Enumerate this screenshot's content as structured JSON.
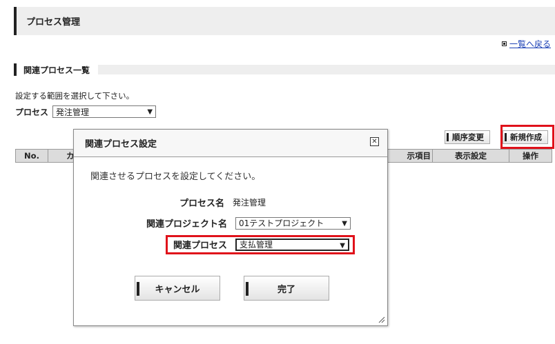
{
  "page": {
    "title": "プロセス管理",
    "back_link": "一覧へ戻る",
    "section_title": "関連プロセス一覧",
    "instruction": "設定する範囲を選択して下さい。",
    "process_label": "プロセス",
    "process_select": "発注管理"
  },
  "toolbar": {
    "reorder_label": "順序変更",
    "new_label": "新規作成"
  },
  "table": {
    "headers": [
      "No.",
      "カ",
      "示項目",
      "表示設定",
      "操作"
    ]
  },
  "modal": {
    "title": "関連プロセス設定",
    "message": "関連させるプロセスを設定してください。",
    "process_name_label": "プロセス名",
    "process_name_value": "発注管理",
    "related_project_label": "関連プロジェクト名",
    "related_project_value": "01テストプロジェクト",
    "related_process_label": "関連プロセス",
    "related_process_value": "支払管理",
    "cancel_label": "キャンセル",
    "done_label": "完了"
  },
  "colors": {
    "highlight": "#e0111a",
    "header_bg": "#eeeeee",
    "link": "#1a3fb5"
  }
}
